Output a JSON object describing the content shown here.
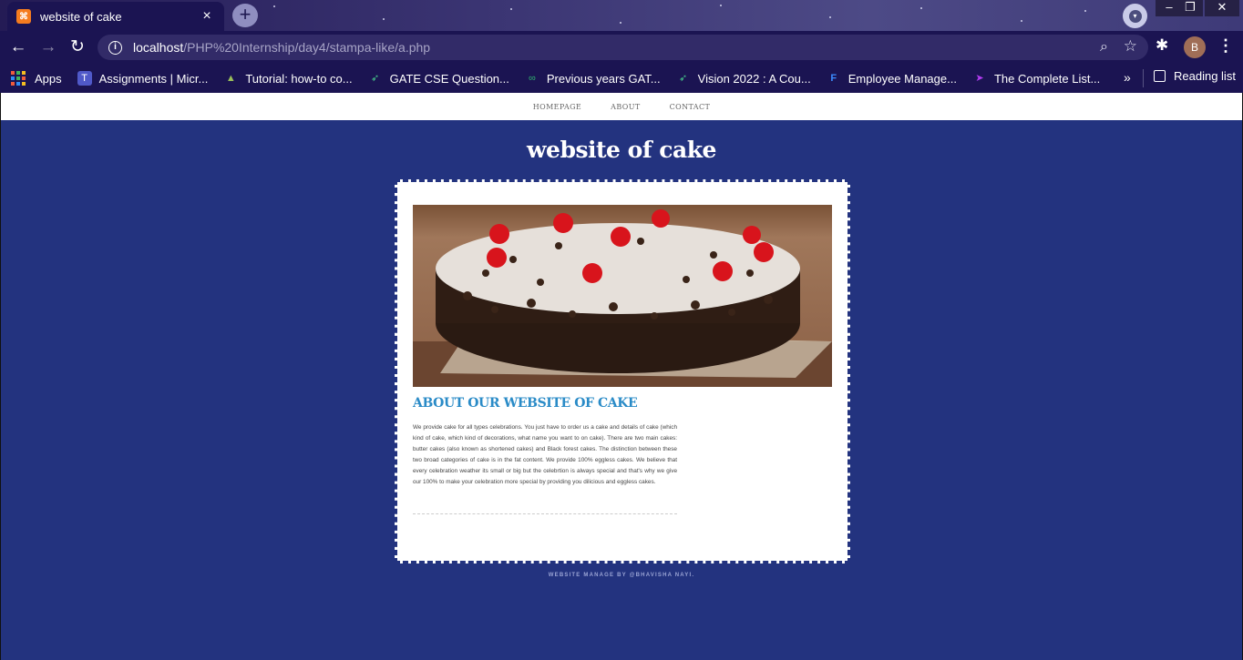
{
  "browser": {
    "tab": {
      "favicon": "xampp-icon",
      "title": "website of cake",
      "close": "×"
    },
    "new_tab": "+",
    "window_controls": {
      "minimize": "–",
      "maximize": "❐",
      "close": "✕"
    },
    "address_bar": {
      "host": "localhost",
      "path": "/PHP%20Internship/day4/stampa-like/a.php"
    },
    "profile_initial": "B",
    "bookmarks": [
      {
        "label": "Apps",
        "icon": "apps-grid-icon"
      },
      {
        "label": "Assignments | Micr...",
        "icon": "teams-icon"
      },
      {
        "label": "Tutorial: how-to co...",
        "icon": "bookmark-icon"
      },
      {
        "label": "GATE CSE Question...",
        "icon": "rocket-icon"
      },
      {
        "label": "Previous years GAT...",
        "icon": "gg-icon"
      },
      {
        "label": "Vision 2022 : A Cou...",
        "icon": "rocket-icon"
      },
      {
        "label": "Employee Manage...",
        "icon": "f-logo-icon"
      },
      {
        "label": "The Complete List...",
        "icon": "pointer-icon"
      }
    ],
    "bookmarks_more": "»",
    "reading_list": "Reading list",
    "colors": {
      "chrome": "#1b1452",
      "omnibox": "#322b68"
    }
  },
  "site": {
    "nav": [
      "HOMEPAGE",
      "ABOUT",
      "CONTACT"
    ],
    "title": "website of cake",
    "about_title": "ABOUT OUR WEBSITE OF CAKE",
    "about_text": "We provide cake for all types celebrations. You just have to order us a cake and details of cake (which kind of cake, which kind of decorations, what name you want to on cake). There are two main cakes: butter cakes (also known as shortened cakes) and Black forest cakes. The distinction between these two broad categories of cake is in the fat content. We provide 100% eggless cakes. We believe that every celebration weather its small or big but the celebrtion is always special and that's why we give our 100% to make your celebration more special by providing you dilicious and eggless cakes.",
    "footer": "Website manage by @Bhavisha Nayi.",
    "colors": {
      "background": "#23337f",
      "accent": "#2a8bc7"
    }
  }
}
